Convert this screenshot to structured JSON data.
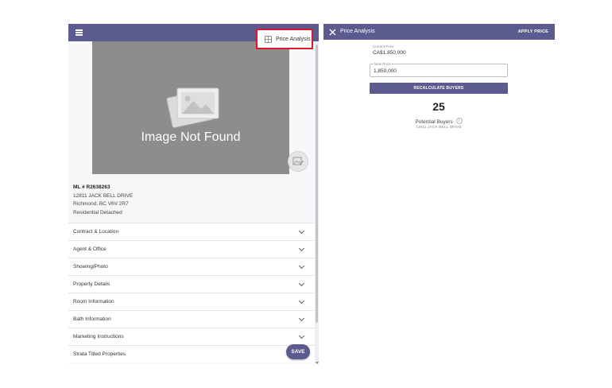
{
  "price_button": {
    "label": "Price Analysis",
    "icon": "calculator-icon"
  },
  "listing": {
    "image_caption": "Image Not Found",
    "ml_number": "ML # R2638263",
    "address_line1": "12811 JACK BELL DRIVE",
    "address_line2": "Richmond, BC V6V 2R7",
    "property_type": "Residential Detached"
  },
  "sections": [
    {
      "label": "Contract & Location"
    },
    {
      "label": "Agent & Office"
    },
    {
      "label": "Showing/Photo"
    },
    {
      "label": "Property Details"
    },
    {
      "label": "Room Information"
    },
    {
      "label": "Bath Information"
    },
    {
      "label": "Marketing Instructions"
    },
    {
      "label": "Strata Titled Properties"
    }
  ],
  "save_label": "SAVE",
  "analysis": {
    "title": "Price Analysis",
    "apply_label": "APPLY PRICE",
    "current_price_label": "Current Price",
    "current_price_value": "CA$1,850,000",
    "new_price_label": "New Price",
    "new_price_value": "1,850,000",
    "recalc_label": "RECALCULATE BUYERS",
    "buyer_count": "25",
    "buyers_label": "Potential Buyers",
    "info_glyph": "i",
    "address": "12811 JACK BELL DRIVE"
  },
  "colors": {
    "header": "#5c5b8f",
    "highlight_border": "#d8182b"
  }
}
